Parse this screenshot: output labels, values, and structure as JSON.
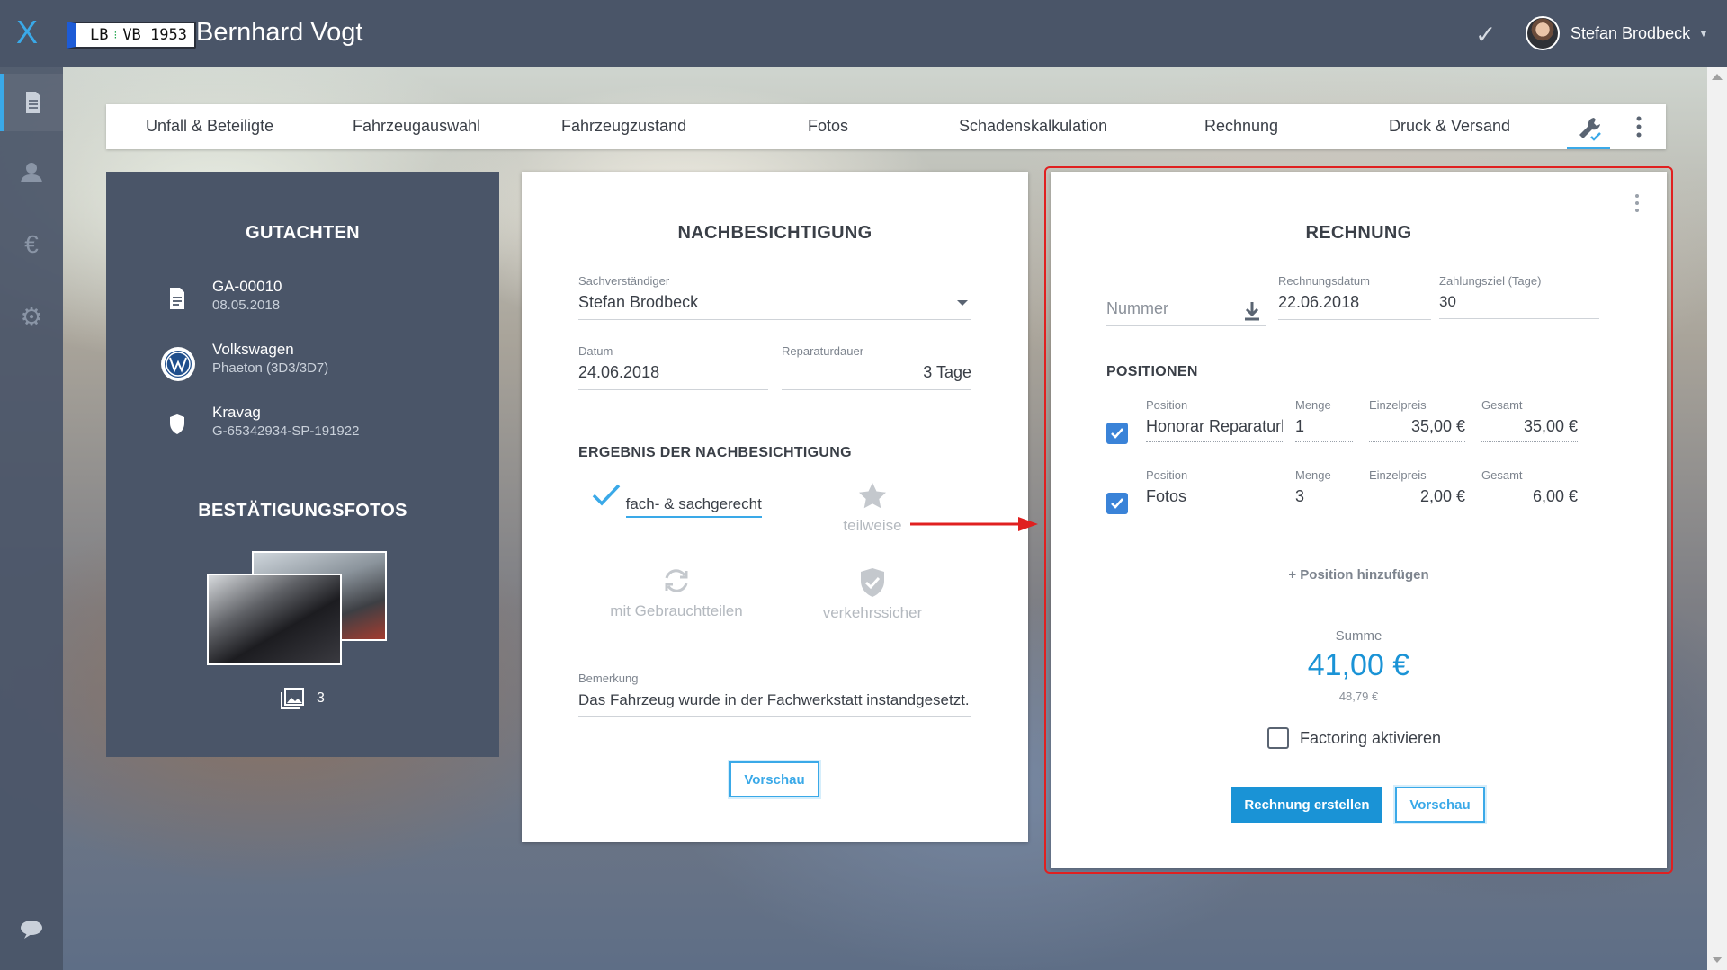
{
  "app": {
    "logo": "X",
    "plate_left": "LB",
    "plate_right": "VB 1953",
    "title": "Bernhard Vogt",
    "user_name": "Stefan Brodbeck"
  },
  "sidebar": {
    "items": [
      {
        "icon": "document-icon",
        "active": true
      },
      {
        "icon": "person-icon",
        "active": false
      },
      {
        "icon": "euro-icon",
        "active": false
      },
      {
        "icon": "gear-icon",
        "active": false
      },
      {
        "icon": "chat-icon",
        "active": false
      }
    ]
  },
  "tabs": [
    {
      "label": "Unfall & Beteiligte"
    },
    {
      "label": "Fahrzeugauswahl"
    },
    {
      "label": "Fahrzeugzustand"
    },
    {
      "label": "Fotos"
    },
    {
      "label": "Schadenskalkulation"
    },
    {
      "label": "Rechnung"
    },
    {
      "label": "Druck & Versand"
    }
  ],
  "gutachten": {
    "heading": "GUTACHTEN",
    "rows": [
      {
        "main": "GA-00010",
        "sub": "08.05.2018",
        "icon": "document-icon"
      },
      {
        "main": "Volkswagen",
        "sub": "Phaeton (3D3/3D7)",
        "icon": "volkswagen-logo-icon"
      },
      {
        "main": "Kravag",
        "sub": "G-65342934-SP-191922",
        "icon": "shield-icon"
      }
    ],
    "photos_heading": "BESTÄTIGUNGSFOTOS",
    "photo_count": "3"
  },
  "nachbesichtigung": {
    "heading": "NACHBESICHTIGUNG",
    "sachverstaendiger_label": "Sachverständiger",
    "sachverstaendiger_value": "Stefan Brodbeck",
    "datum_label": "Datum",
    "datum_value": "24.06.2018",
    "reparaturdauer_label": "Reparaturdauer",
    "reparaturdauer_value": "3 Tage",
    "ergebnis_heading": "ERGEBNIS DER NACHBESICHTIGUNG",
    "options": [
      {
        "label": "fach- & sachgerecht",
        "icon": "check-icon",
        "selected": true
      },
      {
        "label": "teilweise",
        "icon": "star-icon",
        "selected": false
      },
      {
        "label": "mit Gebrauchtteilen",
        "icon": "recycle-icon",
        "selected": false
      },
      {
        "label": "verkehrssicher",
        "icon": "shield-check-icon",
        "selected": false
      }
    ],
    "bemerkung_label": "Bemerkung",
    "bemerkung_value": "Das Fahrzeug wurde in der Fachwerkstatt instandgesetzt.",
    "vorschau_label": "Vorschau"
  },
  "rechnung": {
    "heading": "RECHNUNG",
    "nummer_placeholder": "Nummer",
    "datum_label": "Rechnungsdatum",
    "datum_value": "22.06.2018",
    "zahlungsziel_label": "Zahlungsziel (Tage)",
    "zahlungsziel_value": "30",
    "positionen_heading": "POSITIONEN",
    "col_position": "Position",
    "col_menge": "Menge",
    "col_einzelpreis": "Einzelpreis",
    "col_gesamt": "Gesamt",
    "positions": [
      {
        "name": "Honorar Reparaturbestä",
        "menge": "1",
        "einzelpreis": "35,00 €",
        "gesamt": "35,00 €",
        "checked": true
      },
      {
        "name": "Fotos",
        "menge": "3",
        "einzelpreis": "2,00 €",
        "gesamt": "6,00 €",
        "checked": true
      }
    ],
    "add_position": "+ Position hinzufügen",
    "summe_label": "Summe",
    "summe_value": "41,00 €",
    "summe_brutto": "48,79 €",
    "factoring_label": "Factoring aktivieren",
    "factoring_checked": false,
    "create_button": "Rechnung erstellen",
    "vorschau_label": "Vorschau"
  },
  "colors": {
    "accent": "#3aa9e8",
    "topbar": "#4a5568",
    "highlight_frame": "#e02020",
    "checkbox": "#3a83d8"
  }
}
